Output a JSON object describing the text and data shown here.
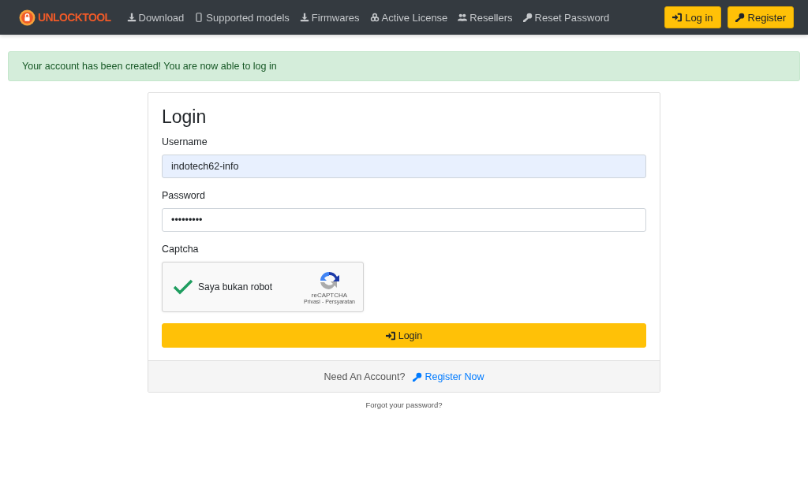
{
  "navbar": {
    "logo": "UNLOCKTOOL",
    "links": [
      {
        "label": "Download",
        "kind": "download"
      },
      {
        "label": "Supported models",
        "kind": "mobile"
      },
      {
        "label": "Firmwares",
        "kind": "download"
      },
      {
        "label": "Active License",
        "kind": "cogs"
      },
      {
        "label": "Resellers",
        "kind": "users"
      },
      {
        "label": "Reset Password",
        "kind": "key"
      }
    ],
    "buttons": [
      {
        "label": "Log in",
        "kind": "signin"
      },
      {
        "label": "Register",
        "kind": "key"
      }
    ]
  },
  "alert": "Your account has been created! You are now able to log in",
  "login": {
    "title": "Login",
    "username": {
      "label": "Username",
      "value": "indotech62-info"
    },
    "password": {
      "label": "Password",
      "value": "•••••••••"
    },
    "captcha": {
      "label": "Captcha",
      "checked": true,
      "text": "Saya bukan robot",
      "brand": "reCAPTCHA",
      "privacy": "Privasi",
      "separator": "-",
      "terms": "Persyaratan"
    },
    "submit": "Login",
    "footer": {
      "prompt": "Need An Account?",
      "link": "Register Now"
    }
  },
  "forgot": "Forgot your password?"
}
